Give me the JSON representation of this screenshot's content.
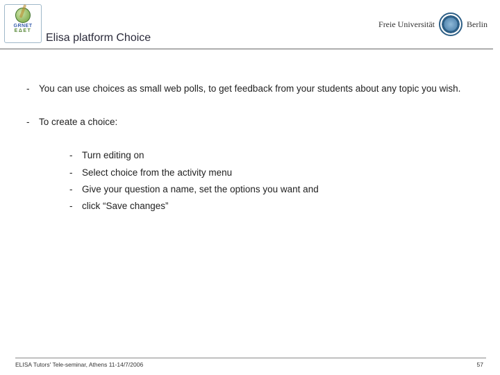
{
  "header": {
    "logo_left": {
      "line1": "GRNET",
      "line2": "ΕΔΕΤ",
      "icon": "globe-arrow-icon"
    },
    "title": "Elisa platform Choice",
    "logo_right": {
      "text": "Freie Universität",
      "text2": "Berlin",
      "icon": "fu-berlin-seal-icon"
    }
  },
  "bullets": {
    "b1": "You can use choices as small web polls, to get feedback from your students about any topic you wish.",
    "b2": "To create a choice:",
    "sub": {
      "s1": "Turn editing on",
      "s2": "Select choice from the activity menu",
      "s3": "Give your question a name, set the options you want and",
      "s4": "click “Save changes”"
    }
  },
  "footer": {
    "left": "ELISA Tutors' Tele-seminar, Athens 11-14/7/2006",
    "page": "57"
  },
  "dash": "-"
}
